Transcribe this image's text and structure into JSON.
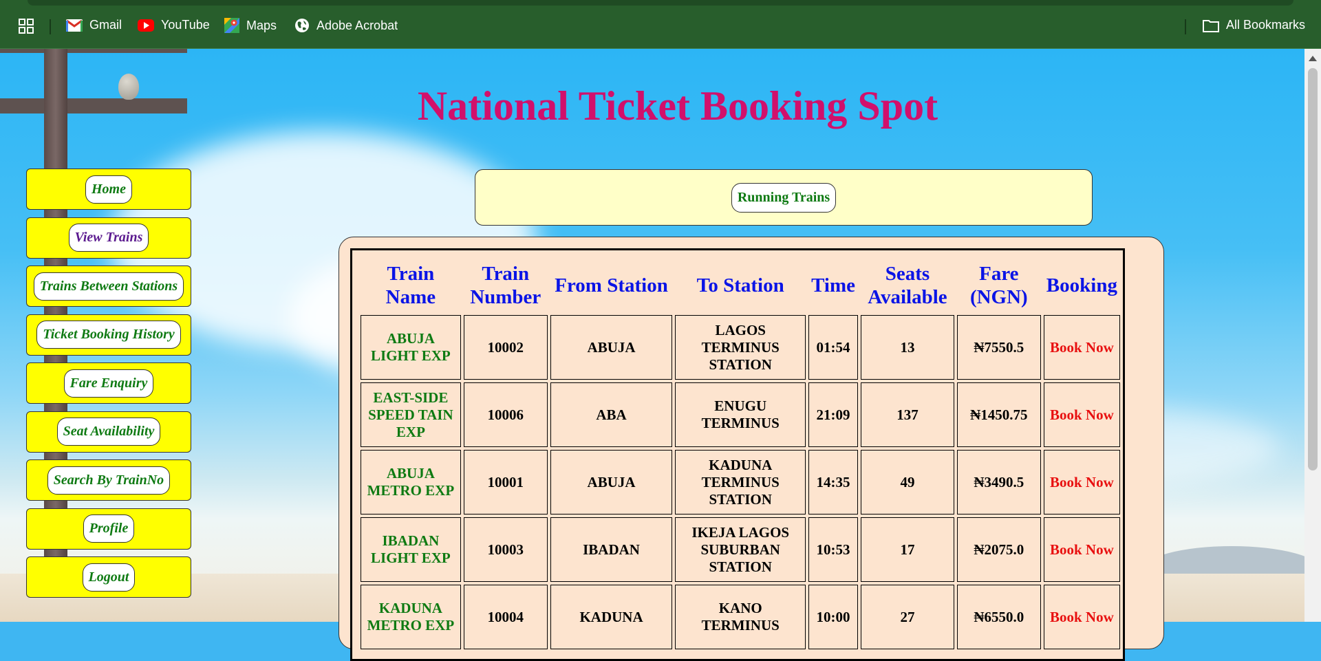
{
  "bookmarks": {
    "items": [
      {
        "label": "Gmail",
        "icon": "gmail-icon"
      },
      {
        "label": "YouTube",
        "icon": "youtube-icon"
      },
      {
        "label": "Maps",
        "icon": "maps-icon"
      },
      {
        "label": "Adobe Acrobat",
        "icon": "globe-icon"
      }
    ],
    "all_bookmarks": "All Bookmarks"
  },
  "page": {
    "title": "National Ticket Booking Spot",
    "running_trains": "Running Trains"
  },
  "menu": {
    "items": [
      {
        "label": "Home"
      },
      {
        "label": "View Trains"
      },
      {
        "label": "Trains Between Stations"
      },
      {
        "label": "Ticket Booking History"
      },
      {
        "label": "Fare Enquiry"
      },
      {
        "label": "Seat Availability"
      },
      {
        "label": "Search By TrainNo"
      },
      {
        "label": "Profile"
      },
      {
        "label": "Logout"
      }
    ]
  },
  "table": {
    "headers": [
      "Train Name",
      "Train Number",
      "From Station",
      "To Station",
      "Time",
      "Seats Available",
      "Fare (NGN)",
      "Booking"
    ],
    "rows": [
      {
        "name": "ABUJA LIGHT EXP",
        "number": "10002",
        "from": "ABUJA",
        "to": "LAGOS TERMINUS STATION",
        "time": "01:54",
        "seats": "13",
        "fare": "₦7550.5",
        "booking": "Book Now"
      },
      {
        "name": "EAST-SIDE SPEED TAIN EXP",
        "number": "10006",
        "from": "ABA",
        "to": "ENUGU TERMINUS",
        "time": "21:09",
        "seats": "137",
        "fare": "₦1450.75",
        "booking": "Book Now"
      },
      {
        "name": "ABUJA METRO EXP",
        "number": "10001",
        "from": "ABUJA",
        "to": "KADUNA TERMINUS STATION",
        "time": "14:35",
        "seats": "49",
        "fare": "₦3490.5",
        "booking": "Book Now"
      },
      {
        "name": "IBADAN LIGHT EXP",
        "number": "10003",
        "from": "IBADAN",
        "to": "IKEJA LAGOS SUBURBAN STATION",
        "time": "10:53",
        "seats": "17",
        "fare": "₦2075.0",
        "booking": "Book Now"
      },
      {
        "name": "KADUNA METRO EXP",
        "number": "10004",
        "from": "KADUNA",
        "to": "KANO TERMINUS",
        "time": "10:00",
        "seats": "27",
        "fare": "₦6550.0",
        "booking": "Book Now"
      }
    ]
  },
  "colors": {
    "title": "#d1106b",
    "menu_bg": "#ffff00",
    "menu_text": "#0e7a12",
    "menu_active_text": "#5b1a8f",
    "header_text": "#0a14e6",
    "book_text": "#e81010",
    "panel_bg": "#fde4cf",
    "bookmarks_bg": "#285e2c"
  }
}
